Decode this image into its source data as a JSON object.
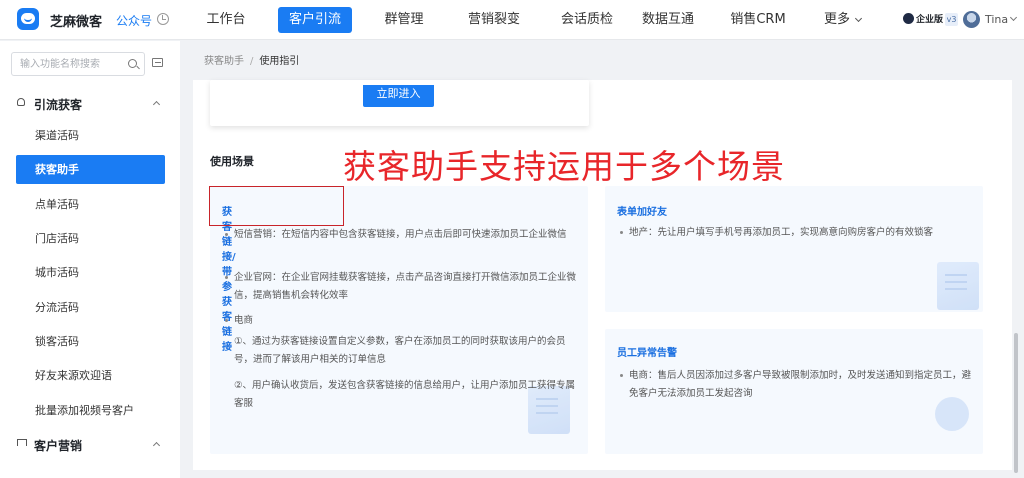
{
  "app": {
    "name": "芝麻微客",
    "account_type": "公众号",
    "history_icon": "history-icon",
    "logo_icon": "chat-bubble-logo-icon"
  },
  "nav": {
    "items": [
      {
        "label": "工作台",
        "active": false
      },
      {
        "label": "客户引流",
        "active": true
      },
      {
        "label": "群管理",
        "active": false
      },
      {
        "label": "营销裂变",
        "active": false
      },
      {
        "label": "会话质检",
        "active": false
      },
      {
        "label": "数据互通",
        "active": false
      },
      {
        "label": "销售CRM",
        "active": false
      },
      {
        "label": "更多",
        "active": false
      }
    ],
    "more_caret": "chevron-down-icon"
  },
  "account": {
    "edition": "企业版",
    "version": "v3",
    "user_name": "Tina"
  },
  "sidebar": {
    "search_placeholder": "输入功能名称搜索",
    "groups": [
      {
        "label": "引流获客",
        "icon": "user-add-icon",
        "expanded": true,
        "items": [
          {
            "label": "渠道活码",
            "active": false
          },
          {
            "label": "获客助手",
            "active": true
          },
          {
            "label": "点单活码",
            "active": false
          },
          {
            "label": "门店活码",
            "active": false
          },
          {
            "label": "城市活码",
            "active": false
          },
          {
            "label": "分流活码",
            "active": false
          },
          {
            "label": "锁客活码",
            "active": false
          },
          {
            "label": "好友来源欢迎语",
            "active": false
          },
          {
            "label": "批量添加视频号客户",
            "active": false
          }
        ]
      },
      {
        "label": "客户营销",
        "icon": "bookmark-icon",
        "expanded": true,
        "items": []
      }
    ]
  },
  "breadcrumb": {
    "parent": "获客助手",
    "separator": "/",
    "current": "使用指引"
  },
  "main": {
    "enter_button": "立即进入",
    "section_title": "使用场景",
    "overlay_caption": "获客助手支持运用于多个场景",
    "cards": {
      "link": {
        "title": "获客链接/带参获客链接",
        "bullets": [
          "短信营销：在短信内容中包含获客链接，用户点击后即可快速添加员工企业微信",
          "企业官网：在企业官网挂载获客链接，点击产品咨询直接打开微信添加员工企业微信，提高销售机会转化效率",
          "电商"
        ],
        "sub_items": [
          "①、通过为获客链接设置自定义参数，客户在添加员工的同时获取该用户的会员号，进而了解该用户相关的订单信息",
          "②、用户确认收货后，发送包含获客链接的信息给用户，让用户添加员工获得专属客服"
        ]
      },
      "form": {
        "title": "表单加好友",
        "bullets": [
          "地产：先让用户填写手机号再添加员工，实现高意向购房客户的有效锁客"
        ]
      },
      "alert": {
        "title": "员工异常告警",
        "bullets": [
          "电商：售后人员因添加过多客户导致被限制添加时，及时发送通知到指定员工，避免客户无法添加员工发起咨询"
        ]
      }
    }
  },
  "colors": {
    "primary": "#1a7cf3",
    "caption_red": "#e8262a",
    "highlight_border": "#c8242a",
    "card_bg": "#f5f9fe"
  }
}
